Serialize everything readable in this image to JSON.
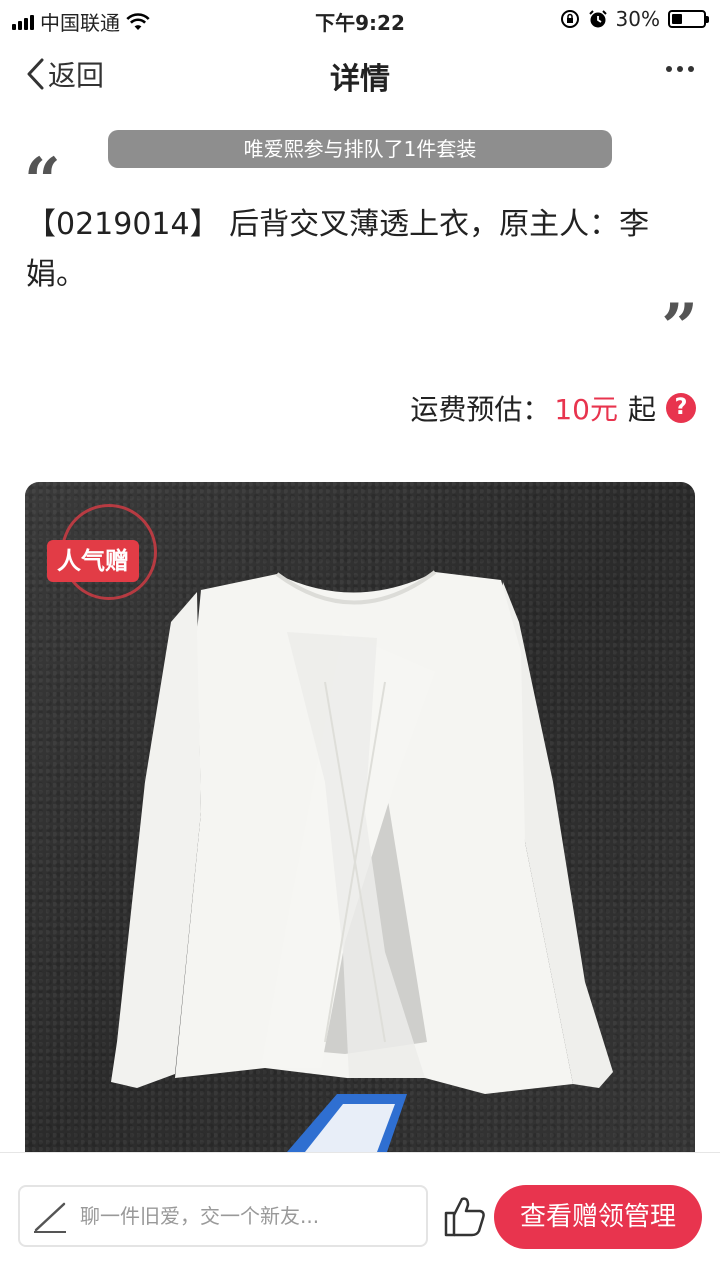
{
  "status_bar": {
    "carrier": "中国联通",
    "time": "下午9:22",
    "battery": "30%"
  },
  "nav": {
    "back_label": "返回",
    "title": "详情"
  },
  "toast": "唯爱熙参与排队了1件套装",
  "item": {
    "description": "【0219014】 后背交叉薄透上衣，原主人：李娟。"
  },
  "shipping": {
    "label": "运费预估：",
    "price": "10元",
    "suffix": "起",
    "help_symbol": "?"
  },
  "photo": {
    "badge": "人气赠"
  },
  "bottom": {
    "comment_placeholder": "聊一件旧爱，交一个新友...",
    "cta_label": "查看赠领管理"
  },
  "colors": {
    "accent": "#e8344e",
    "toast_bg": "#8e8e8e"
  },
  "icons": {
    "back": "chevron-left-icon",
    "more": "more-dots-icon",
    "help": "question-circle-icon",
    "pen": "pen-icon",
    "like": "thumbs-up-icon",
    "wifi": "wifi-icon",
    "signal": "signal-icon",
    "alarm": "alarm-icon",
    "lock": "orientation-lock-icon"
  }
}
